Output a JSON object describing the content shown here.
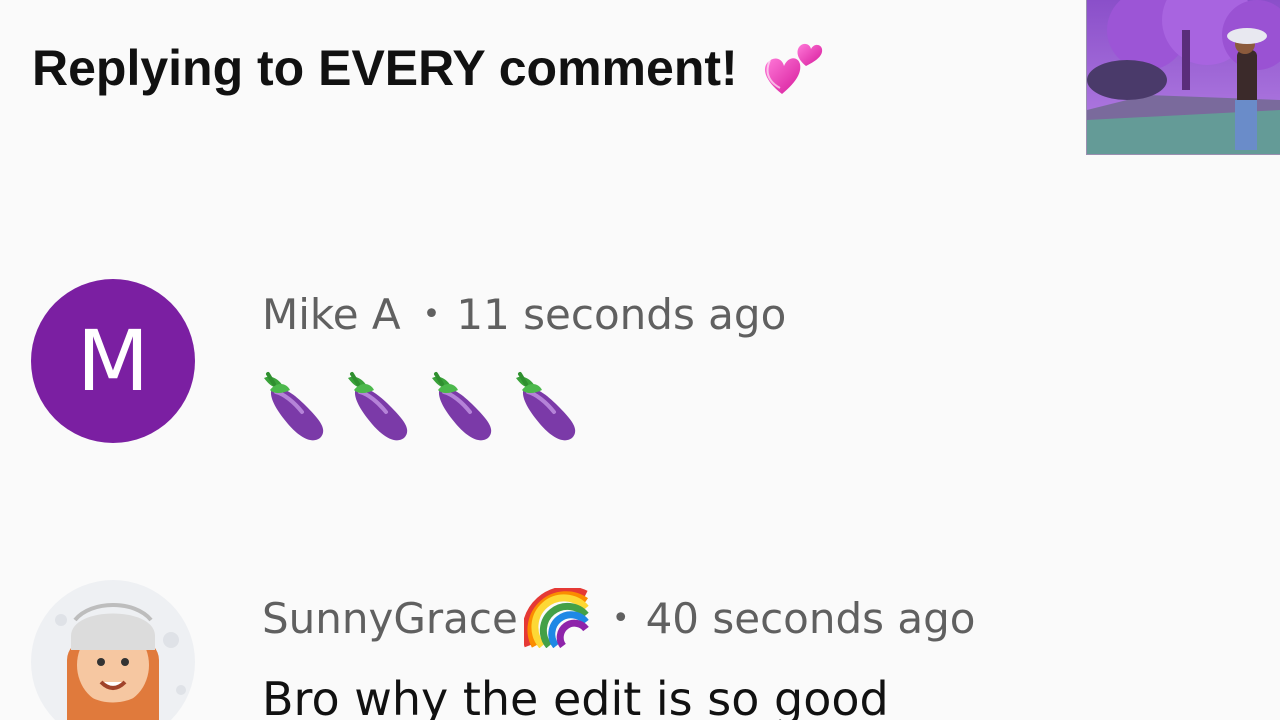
{
  "video": {
    "title": "Replying to EVERY comment!",
    "title_emoji": "revolving-hearts-icon"
  },
  "comments": [
    {
      "author": "Mike A",
      "avatar_letter": "M",
      "separator": "•",
      "timestamp": "11 seconds ago",
      "body_icons": [
        "eggplant-icon",
        "eggplant-icon",
        "eggplant-icon",
        "eggplant-icon"
      ],
      "avatar_color": "#7b1fa2"
    },
    {
      "author": "SunnyGrace",
      "author_emoji": "rainbow-icon",
      "separator": "•",
      "timestamp": "40 seconds ago",
      "body": "Bro why the edit is so good"
    }
  ]
}
